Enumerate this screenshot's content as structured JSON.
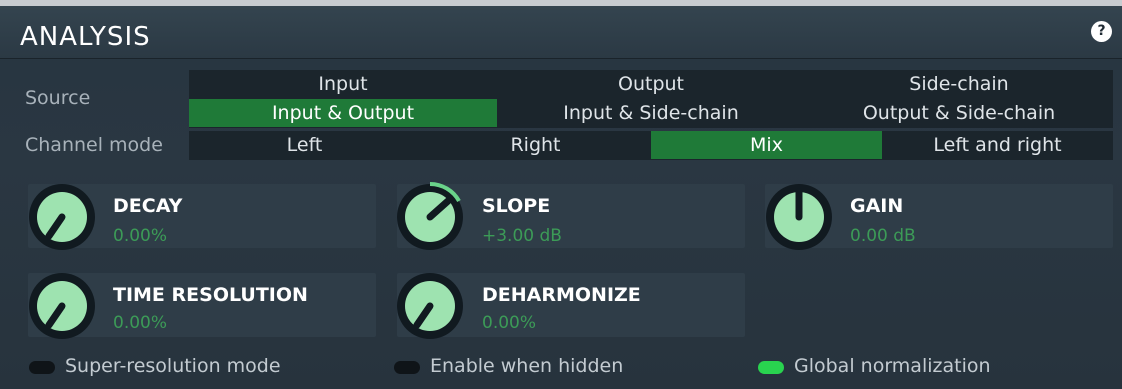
{
  "header": {
    "title": "ANALYSIS",
    "help_label": "?"
  },
  "source": {
    "label": "Source",
    "options": [
      {
        "label": "Input",
        "selected": false
      },
      {
        "label": "Output",
        "selected": false
      },
      {
        "label": "Side-chain",
        "selected": false
      },
      {
        "label": "Input & Output",
        "selected": true
      },
      {
        "label": "Input & Side-chain",
        "selected": false
      },
      {
        "label": "Output & Side-chain",
        "selected": false
      }
    ]
  },
  "channel_mode": {
    "label": "Channel mode",
    "options": [
      {
        "label": "Left",
        "selected": false
      },
      {
        "label": "Right",
        "selected": false
      },
      {
        "label": "Mix",
        "selected": true
      },
      {
        "label": "Left and right",
        "selected": false
      }
    ]
  },
  "knobs": [
    {
      "name": "DECAY",
      "value": "0.00%"
    },
    {
      "name": "SLOPE",
      "value": "+3.00 dB"
    },
    {
      "name": "GAIN",
      "value": "0.00 dB"
    },
    {
      "name": "TIME RESOLUTION",
      "value": "0.00%"
    },
    {
      "name": "DEHARMONIZE",
      "value": "0.00%"
    }
  ],
  "toggles": [
    {
      "label": "Super-resolution mode",
      "on": false
    },
    {
      "label": "Enable when hidden",
      "on": false
    },
    {
      "label": "Global normalization",
      "on": true
    }
  ],
  "colors": {
    "accent": "#1f7a38",
    "value_text": "#3c9b57",
    "knob_face": "#9ee3b0",
    "toggle_on": "#29d34f"
  }
}
